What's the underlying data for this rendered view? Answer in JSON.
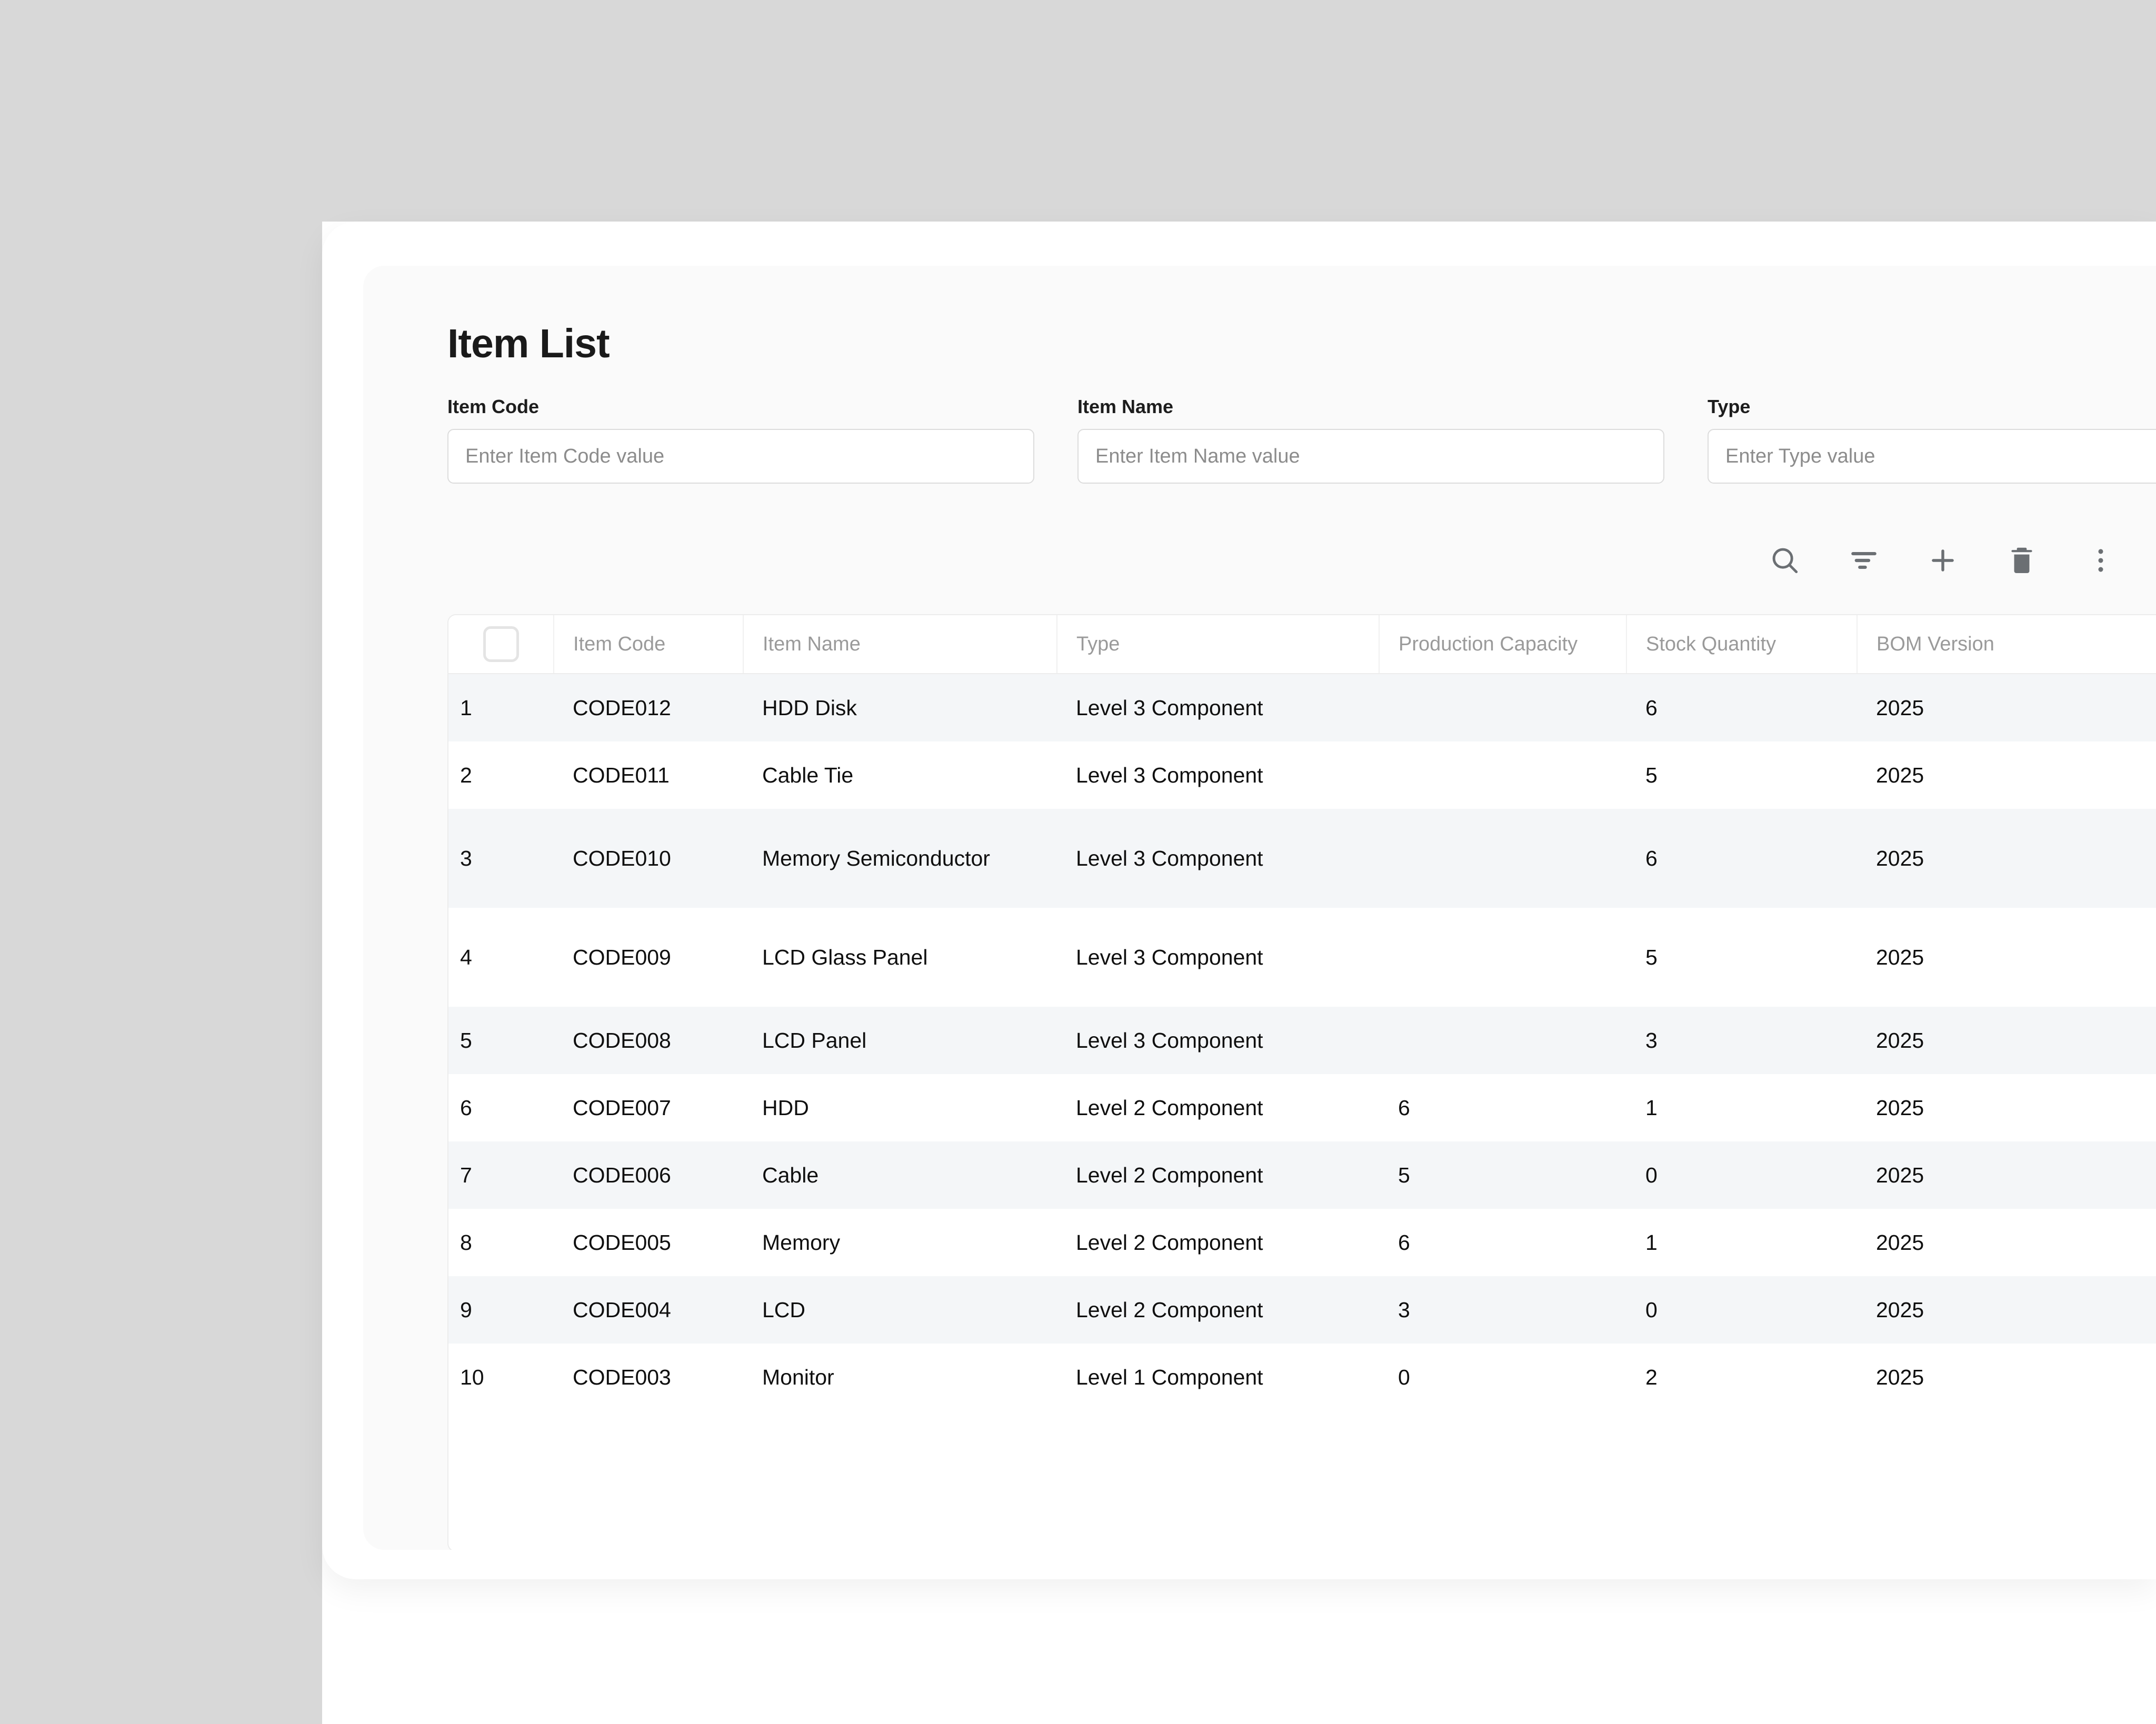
{
  "page": {
    "title": "Item List"
  },
  "filters": [
    {
      "label": "Item Code",
      "placeholder": "Enter Item Code value",
      "value": ""
    },
    {
      "label": "Item Name",
      "placeholder": "Enter Item Name value",
      "value": ""
    },
    {
      "label": "Type",
      "placeholder": "Enter Type value",
      "value": ""
    }
  ],
  "toolbar": {
    "icons": [
      {
        "name": "search-icon",
        "glyph": "magnifier"
      },
      {
        "name": "filter-icon",
        "glyph": "filter-lines"
      },
      {
        "name": "add-icon",
        "glyph": "plus"
      },
      {
        "name": "delete-icon",
        "glyph": "trash"
      },
      {
        "name": "more-options-icon",
        "glyph": "vertical-ellipsis"
      }
    ]
  },
  "table": {
    "select_all_checked": false,
    "columns": [
      "Item Code",
      "Item Name",
      "Type",
      "Production Capacity",
      "Stock Quantity",
      "BOM Version"
    ],
    "rows": [
      {
        "index": "1",
        "item_code": "CODE012",
        "item_name": "HDD Disk",
        "type": "Level 3 Component",
        "production_capacity": "",
        "stock_quantity": "6",
        "bom_version": "2025"
      },
      {
        "index": "2",
        "item_code": "CODE011",
        "item_name": "Cable Tie",
        "type": "Level 3 Component",
        "production_capacity": "",
        "stock_quantity": "5",
        "bom_version": "2025"
      },
      {
        "index": "3",
        "item_code": "CODE010",
        "item_name": "Memory Semiconductor",
        "type": "Level 3 Component",
        "production_capacity": "",
        "stock_quantity": "6",
        "bom_version": "2025"
      },
      {
        "index": "4",
        "item_code": "CODE009",
        "item_name": "LCD Glass Panel",
        "type": "Level 3 Component",
        "production_capacity": "",
        "stock_quantity": "5",
        "bom_version": "2025"
      },
      {
        "index": "5",
        "item_code": "CODE008",
        "item_name": "LCD Panel",
        "type": "Level 3 Component",
        "production_capacity": "",
        "stock_quantity": "3",
        "bom_version": "2025"
      },
      {
        "index": "6",
        "item_code": "CODE007",
        "item_name": "HDD",
        "type": "Level 2 Component",
        "production_capacity": "6",
        "stock_quantity": "1",
        "bom_version": "2025"
      },
      {
        "index": "7",
        "item_code": "CODE006",
        "item_name": "Cable",
        "type": "Level 2 Component",
        "production_capacity": "5",
        "stock_quantity": "0",
        "bom_version": "2025"
      },
      {
        "index": "8",
        "item_code": "CODE005",
        "item_name": "Memory",
        "type": "Level 2 Component",
        "production_capacity": "6",
        "stock_quantity": "1",
        "bom_version": "2025"
      },
      {
        "index": "9",
        "item_code": "CODE004",
        "item_name": "LCD",
        "type": "Level 2 Component",
        "production_capacity": "3",
        "stock_quantity": "0",
        "bom_version": "2025"
      },
      {
        "index": "10",
        "item_code": "CODE003",
        "item_name": "Monitor",
        "type": "Level 1 Component",
        "production_capacity": "0",
        "stock_quantity": "2",
        "bom_version": "2025"
      }
    ]
  },
  "colors": {
    "backdrop": "#d8d8d8",
    "card": "#ffffff",
    "panel": "#fafafa",
    "row_stripe": "#f4f6f8",
    "header_text": "#9a9a9a",
    "body_text": "#0f0f0f",
    "icon": "#6b6f73",
    "input_border": "#dcdcdc",
    "placeholder": "#8c8c8c"
  }
}
